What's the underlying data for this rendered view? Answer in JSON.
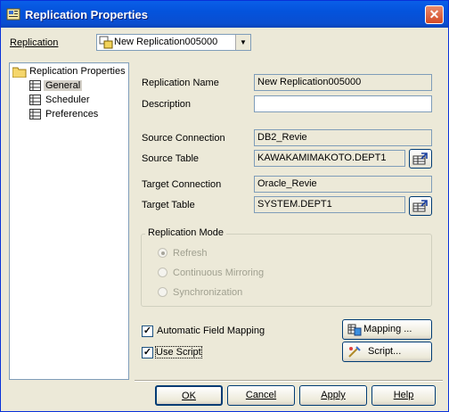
{
  "window": {
    "title": "Replication Properties",
    "close_glyph": "✕"
  },
  "replication": {
    "label": "Replication",
    "selected": "New Replication005000"
  },
  "tree": {
    "root": "Replication Properties",
    "items": [
      "General",
      "Scheduler",
      "Preferences"
    ]
  },
  "form": {
    "name_label": "Replication Name",
    "name_value": "New Replication005000",
    "description_label": "Description",
    "description_value": "",
    "source_connection_label": "Source Connection",
    "source_connection_value": "DB2_Revie",
    "source_table_label": "Source Table",
    "source_table_value": "KAWAKAMIMAKOTO.DEPT1",
    "target_connection_label": "Target Connection",
    "target_connection_value": "Oracle_Revie",
    "target_table_label": "Target Table",
    "target_table_value": "SYSTEM.DEPT1"
  },
  "mode": {
    "title": "Replication Mode",
    "options": [
      "Refresh",
      "Continuous Mirroring",
      "Synchronization"
    ],
    "selected_index": 0
  },
  "options": {
    "auto_mapping_label": "Automatic Field Mapping",
    "auto_mapping_checked": true,
    "use_script_label": "Use Script",
    "use_script_checked": true,
    "check_glyph": "✓"
  },
  "side_buttons": {
    "mapping": "Mapping ...",
    "script": "Script..."
  },
  "buttons": {
    "ok": "OK",
    "cancel": "Cancel",
    "apply": "Apply",
    "help": "Help"
  },
  "colors": {
    "titlebar": "#0453dc",
    "face": "#ece9d8",
    "field_border": "#7f9db9"
  }
}
